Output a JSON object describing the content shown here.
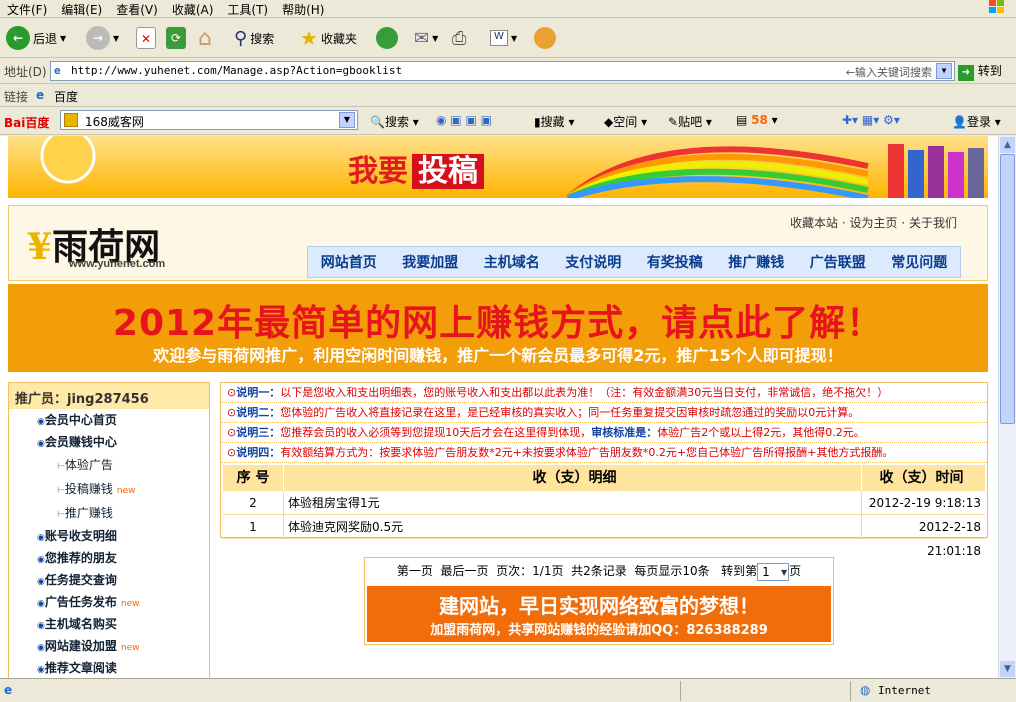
{
  "browser": {
    "menu": [
      "文件(F)",
      "编辑(E)",
      "查看(V)",
      "收藏(A)",
      "工具(T)",
      "帮助(H)"
    ],
    "toolbar": {
      "back": "后退",
      "search": "搜索",
      "favorites": "收藏夹"
    },
    "address_label": "地址(D)",
    "url": "http://www.yuhenet.com/Manage.asp?Action=gbooklist",
    "address_hint": "←输入关键词搜索",
    "go": "转到",
    "links_label": "链接",
    "links_item": "百度",
    "baidu_logo": "Bai百度",
    "baidu_input": "168威客网",
    "baidu_items": [
      "搜索",
      "搜藏",
      "空间",
      "贴吧",
      "58",
      "登录"
    ],
    "status": "Internet"
  },
  "site": {
    "top_banner": {
      "text": "我要",
      "highlight": "投稿"
    },
    "logo": {
      "name": "雨荷网",
      "domain": "www.yuhenet.com"
    },
    "top_links": [
      "收藏本站",
      "设为主页",
      "关于我们"
    ],
    "nav": [
      "网站首页",
      "我要加盟",
      "主机域名",
      "支付说明",
      "有奖投稿",
      "推广赚钱",
      "广告联盟",
      "常见问题"
    ],
    "big_banner": {
      "line1": "2012年最简单的网上赚钱方式，请点此了解！",
      "line2": "欢迎参与雨荷网推广，利用空闲时间赚钱，推广一个新会员最多可得2元，推广15个人即可提现！"
    },
    "sidebar": {
      "header": "推广员：jing287456",
      "items": [
        {
          "label": "会员中心首页",
          "sub": false,
          "new": false
        },
        {
          "label": "会员赚钱中心",
          "sub": false,
          "new": false
        },
        {
          "label": "体验广告",
          "sub": true,
          "new": false
        },
        {
          "label": "投稿赚钱",
          "sub": true,
          "new": true
        },
        {
          "label": "推广赚钱",
          "sub": true,
          "new": false
        },
        {
          "label": "账号收支明细",
          "sub": false,
          "new": false
        },
        {
          "label": "您推荐的朋友",
          "sub": false,
          "new": false
        },
        {
          "label": "任务提交查询",
          "sub": false,
          "new": false
        },
        {
          "label": "广告任务发布",
          "sub": false,
          "new": true
        },
        {
          "label": "主机域名购买",
          "sub": false,
          "new": false
        },
        {
          "label": "网站建设加盟",
          "sub": false,
          "new": true
        },
        {
          "label": "推荐文章阅读",
          "sub": false,
          "new": false
        }
      ],
      "new_badge": "new"
    },
    "notes": [
      {
        "label": "说明一：",
        "text": "以下是您收入和支出明细表，您的账号收入和支出都以此表为准！（注：有效金额满30元当日支付，非常诚信，绝不拖欠！）"
      },
      {
        "label": "说明二：",
        "text": "您体验的广告收入将直接记录在这里，是已经审核的真实收入；同一任务重复提交因审核时疏忽通过的奖励以0元计算。"
      },
      {
        "label": "说明三：",
        "text": "您推荐会员的收入必须等到您提现10天后才会在这里得到体现，",
        "bold": "审核标准是：",
        "tail": "体验广告2个或以上得2元，其他得0.2元。"
      },
      {
        "label": "说明四：",
        "text": "有效额结算方式为：按要求体验广告朋友数*2元+未按要求体验广告朋友数*0.2元+您自己体验广告所得报酬+其他方式报酬。"
      }
    ],
    "table": {
      "headers": [
        "序 号",
        "收（支）明细",
        "收（支）时间"
      ],
      "rows": [
        {
          "no": "2",
          "detail": "体验租房宝得1元",
          "time": "2012-2-19 9:18:13"
        },
        {
          "no": "1",
          "detail": "体验迪克网奖励0.5元",
          "time": "2012-2-18 21:01:18"
        }
      ]
    },
    "pager": {
      "first": "第一页",
      "last": "最后一页",
      "pages": "页次：1/1页",
      "records": "共2条记录",
      "per_page": "每页显示10条",
      "goto": "转到第",
      "page_value": "1",
      "page_unit": "页"
    },
    "promo": {
      "line1": "建网站，早日实现网络致富的梦想！",
      "line2": "加盟雨荷网，共享网站赚钱的经验请加QQ：826388289"
    }
  }
}
